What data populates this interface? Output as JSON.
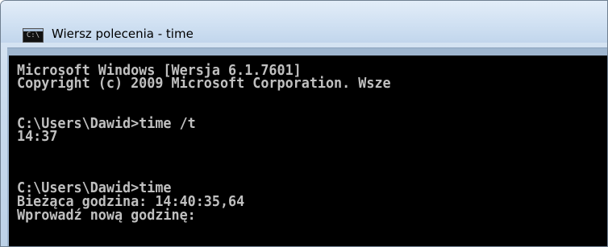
{
  "window": {
    "title": "Wiersz polecenia - time",
    "icon": "cmd-icon",
    "icon_glyph": "C:\\"
  },
  "console": {
    "lines": [
      "Microsoft Windows [Wersja 6.1.7601]",
      "Copyright (c) 2009 Microsoft Corporation. Wsze",
      "C:\\Users\\Dawid>time /t",
      "14:37",
      "C:\\Users\\Dawid>time",
      "Bieżąca godzina: 14:40:35,64",
      "Wprowadź nową godzinę:"
    ],
    "text_color": "#c0c0c0",
    "background_color": "#000000"
  }
}
